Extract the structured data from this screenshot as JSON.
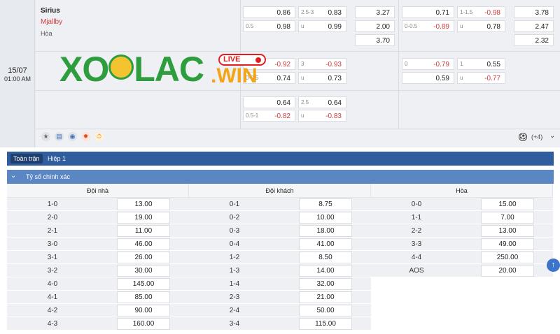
{
  "match": {
    "date": "15/07",
    "time": "01:00 AM",
    "home": "Sirius",
    "away": "Mjallby",
    "draw": "Hòa",
    "more_count": "(+4)"
  },
  "logo": {
    "text": "XOILAC",
    "tld": ".WIN",
    "live": "LIVE"
  },
  "odds": {
    "r1": {
      "a1": "0.86",
      "a2": "0.98",
      "a2h": "0.5",
      "b1h": "2.5-3",
      "b1": "0.83",
      "b2h": "u",
      "b2": "0.99",
      "c1": "3.27",
      "c2": "2.00",
      "c3": "3.70",
      "d1": "0.71",
      "d2h": "0-0.5",
      "d2": "-0.89",
      "e1h": "1-1.5",
      "e1": "-0.98",
      "e2h": "u",
      "e2": "0.78",
      "f1": "3.78",
      "f2": "2.47",
      "f3": "2.32"
    },
    "r2": {
      "a1": "-0.92",
      "a2h": "0-0.5",
      "a2": "0.74",
      "b1h": "3",
      "b1": "-0.93",
      "b2h": "u",
      "b2": "0.73",
      "d1h": "0",
      "d1": "-0.79",
      "d2": "0.59",
      "e1h": "1",
      "e1": "0.55",
      "e2h": "u",
      "e2": "-0.77"
    },
    "r3": {
      "a1": "0.64",
      "a2h": "0.5-1",
      "a2": "-0.82",
      "b1h": "2.5",
      "b1": "0.64",
      "b2h": "u",
      "b2": "-0.83"
    }
  },
  "tabs": {
    "full": "Toàn trận",
    "half": "Hiệp 1"
  },
  "section": {
    "title": "Tỷ số chính xác"
  },
  "columns": {
    "home": {
      "header": "Đội nhà",
      "rows": [
        {
          "score": "1-0",
          "odd": "13.00"
        },
        {
          "score": "2-0",
          "odd": "19.00"
        },
        {
          "score": "2-1",
          "odd": "11.00"
        },
        {
          "score": "3-0",
          "odd": "46.00"
        },
        {
          "score": "3-1",
          "odd": "26.00"
        },
        {
          "score": "3-2",
          "odd": "30.00"
        },
        {
          "score": "4-0",
          "odd": "145.00"
        },
        {
          "score": "4-1",
          "odd": "85.00"
        },
        {
          "score": "4-2",
          "odd": "90.00"
        },
        {
          "score": "4-3",
          "odd": "160.00"
        }
      ]
    },
    "away": {
      "header": "Đội khách",
      "rows": [
        {
          "score": "0-1",
          "odd": "8.75"
        },
        {
          "score": "0-2",
          "odd": "10.00"
        },
        {
          "score": "0-3",
          "odd": "18.00"
        },
        {
          "score": "0-4",
          "odd": "41.00"
        },
        {
          "score": "1-2",
          "odd": "8.50"
        },
        {
          "score": "1-3",
          "odd": "14.00"
        },
        {
          "score": "1-4",
          "odd": "32.00"
        },
        {
          "score": "2-3",
          "odd": "21.00"
        },
        {
          "score": "2-4",
          "odd": "50.00"
        },
        {
          "score": "3-4",
          "odd": "115.00"
        }
      ]
    },
    "draw": {
      "header": "Hòa",
      "rows": [
        {
          "score": "0-0",
          "odd": "15.00"
        },
        {
          "score": "1-1",
          "odd": "7.00"
        },
        {
          "score": "2-2",
          "odd": "13.00"
        },
        {
          "score": "3-3",
          "odd": "49.00"
        },
        {
          "score": "4-4",
          "odd": "250.00"
        },
        {
          "score": "AOS",
          "odd": "20.00"
        }
      ]
    }
  },
  "colors": {
    "accent": "#2f5d9e",
    "section": "#5b86c4",
    "negative": "#d23b3b",
    "logo_green": "#2e9d3e",
    "logo_orange": "#f2a516"
  },
  "icons": [
    "star-icon",
    "stats-icon",
    "eye-icon",
    "fire-icon",
    "timer-icon",
    "soccer-ball-icon",
    "chevron-down-icon",
    "arrow-up-icon"
  ]
}
